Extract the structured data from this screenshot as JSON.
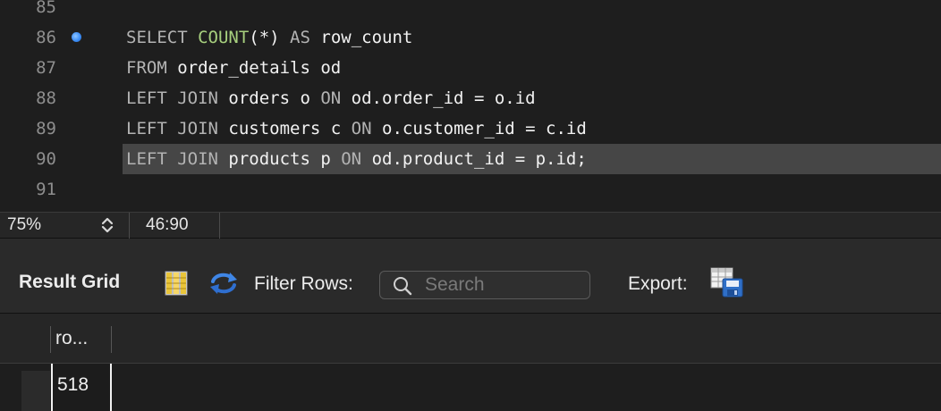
{
  "editor": {
    "lines": [
      {
        "num": "85",
        "tokens": []
      },
      {
        "num": "86",
        "marker": true,
        "tokens": [
          {
            "t": "kw",
            "v": "SELECT "
          },
          {
            "t": "fn",
            "v": "COUNT"
          },
          {
            "t": "op",
            "v": "(*) "
          },
          {
            "t": "kw",
            "v": "AS "
          },
          {
            "t": "id",
            "v": "row_count"
          }
        ]
      },
      {
        "num": "87",
        "tokens": [
          {
            "t": "kw",
            "v": "FROM "
          },
          {
            "t": "id",
            "v": "order_details od"
          }
        ]
      },
      {
        "num": "88",
        "tokens": [
          {
            "t": "kw",
            "v": "LEFT JOIN "
          },
          {
            "t": "id",
            "v": "orders o "
          },
          {
            "t": "kw",
            "v": "ON "
          },
          {
            "t": "id",
            "v": "od.order_id = o.id"
          }
        ]
      },
      {
        "num": "89",
        "tokens": [
          {
            "t": "kw",
            "v": "LEFT JOIN "
          },
          {
            "t": "id",
            "v": "customers c "
          },
          {
            "t": "kw",
            "v": "ON "
          },
          {
            "t": "id",
            "v": "o.customer_id = c.id"
          }
        ]
      },
      {
        "num": "90",
        "current": true,
        "tokens": [
          {
            "t": "kw",
            "v": "LEFT JOIN "
          },
          {
            "t": "id",
            "v": "products p "
          },
          {
            "t": "kw",
            "v": "ON "
          },
          {
            "t": "id",
            "v": "od.product_id = p.id;"
          }
        ]
      },
      {
        "num": "91",
        "tokens": []
      }
    ]
  },
  "status": {
    "zoom": "75%",
    "cursor": "46:90"
  },
  "result_toolbar": {
    "title": "Result Grid",
    "filter_label": "Filter Rows:",
    "search_placeholder": "Search",
    "search_value": "",
    "export_label": "Export:",
    "icons": {
      "grid": "grid-toggle-icon",
      "refresh": "refresh-icon",
      "search": "search-icon",
      "export": "export-icon"
    }
  },
  "grid": {
    "columns": [
      "ro..."
    ],
    "rows": [
      [
        "518"
      ]
    ]
  },
  "colors": {
    "background": "#1e1e1e",
    "keyword": "#b3b3b3",
    "function": "#a7d07e",
    "current_line": "#464646",
    "accent": "#3d8ef5"
  }
}
